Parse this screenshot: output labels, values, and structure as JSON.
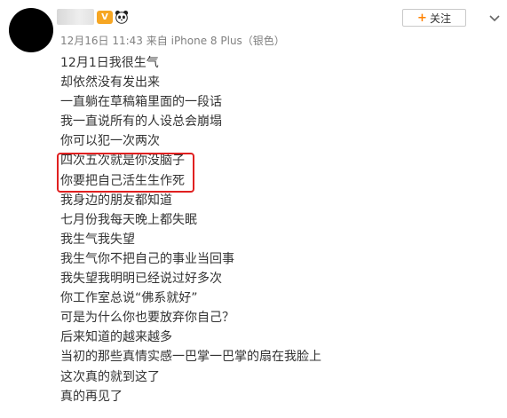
{
  "post": {
    "author_badge": "V",
    "follow_label": "关注",
    "follow_plus": "+",
    "timestamp": "12月16日 11:43",
    "source_prefix": "来自",
    "source_device": "iPhone 8 Plus（银色）",
    "lines": [
      "12月1日我很生气",
      "却依然没有发出来",
      "一直躺在草稿箱里面的一段话",
      "我一直说所有的人设总会崩塌",
      "你可以犯一次两次",
      "四次五次就是你没脑子",
      "你要把自己活生生作死",
      "我身边的朋友都知道",
      "七月份我每天晚上都失眠",
      "我生气我失望",
      "我生气你不把自己的事业当回事",
      "我失望我明明已经说过好多次",
      "你工作室总说“佛系就好”",
      "可是为什么你也要放弃你自己？",
      "后来知道的越来越多",
      "当初的那些真情实感一巴掌一巴掌的扇在我脸上",
      "这次真的就到这了",
      "真的再见了"
    ]
  },
  "colors": {
    "accent": "#ff8200",
    "highlight_border": "#e02020",
    "meta_text": "#808080",
    "body_text": "#333333"
  },
  "icons": [
    "vip-badge-icon",
    "panda-icon",
    "chevron-down-icon"
  ]
}
